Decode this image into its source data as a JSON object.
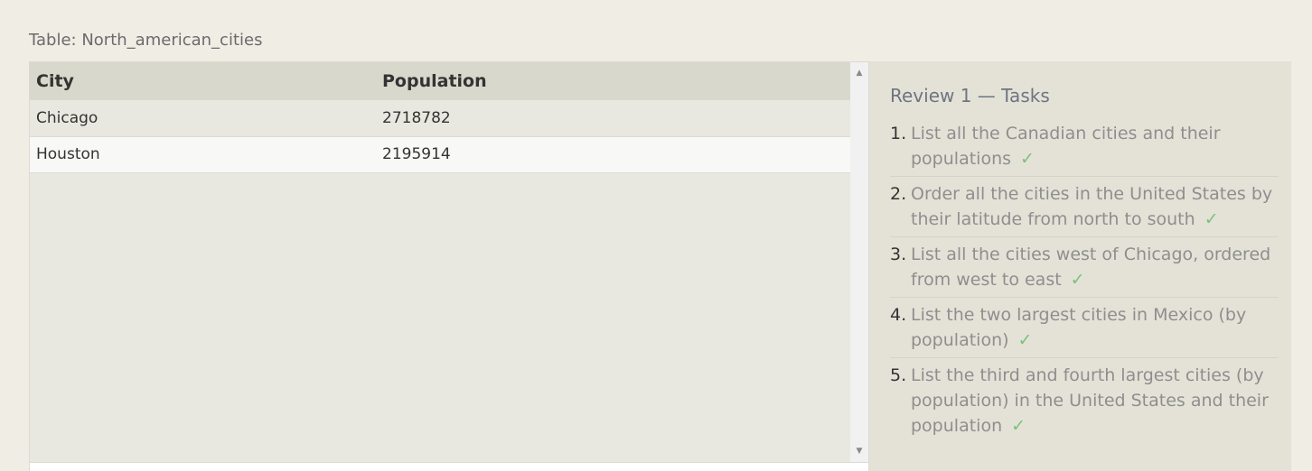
{
  "table": {
    "caption": "Table: North_american_cities",
    "columns": [
      "City",
      "Population"
    ],
    "rows": [
      {
        "city": "Chicago",
        "population": "2718782"
      },
      {
        "city": "Houston",
        "population": "2195914"
      }
    ]
  },
  "scrollbar": {
    "up_icon": "▲",
    "down_icon": "▼"
  },
  "review": {
    "title": "Review 1 — Tasks",
    "check_icon": "✓",
    "tasks": [
      {
        "number": "1.",
        "text": "List all the Canadian cities and their populations"
      },
      {
        "number": "2.",
        "text": "Order all the cities in the United States by their latitude from north to south"
      },
      {
        "number": "3.",
        "text": "List all the cities west of Chicago, ordered from west to east"
      },
      {
        "number": "4.",
        "text": "List the two largest cities in Mexico (by population)"
      },
      {
        "number": "5.",
        "text": "List the third and fourth largest cities (by population) in the United States and their population"
      }
    ]
  },
  "colors": {
    "page_background": "#f0ede5",
    "header_background": "#d9d8cc",
    "review_background": "#e4e2d7",
    "check_color": "#7cc17c"
  }
}
